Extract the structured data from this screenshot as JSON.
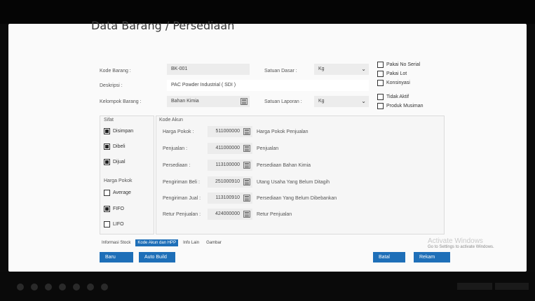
{
  "title": "Data Barang / Persediaan",
  "form": {
    "kode_barang_label": "Kode Barang :",
    "kode_barang_value": "BK-001",
    "deskripsi_label": "Deskripsi :",
    "deskripsi_value": "PAC Powder Industrial ( SDI )",
    "kelompok_label": "Kelompok Barang :",
    "kelompok_value": "Bahan Kimia",
    "satuan_dasar_label": "Satuan Dasar :",
    "satuan_dasar_value": "Kg",
    "satuan_laporan_label": "Satuan Laporan :",
    "satuan_laporan_value": "Kg"
  },
  "options": [
    {
      "label": "Pakai No Serial",
      "checked": false
    },
    {
      "label": "Pakai Lot",
      "checked": false
    },
    {
      "label": "Konsinyasi",
      "checked": false
    },
    {
      "label": "Tidak Aktif",
      "checked": false
    },
    {
      "label": "Produk Musiman",
      "checked": false
    }
  ],
  "sifat": {
    "header": "Sifat",
    "items": [
      {
        "label": "Disimpan",
        "checked": true
      },
      {
        "label": "Dibeli",
        "checked": true
      },
      {
        "label": "Dijual",
        "checked": true
      }
    ]
  },
  "harga_pokok": {
    "header": "Harga Pokok",
    "items": [
      {
        "label": "Average",
        "checked": false
      },
      {
        "label": "FIFO",
        "checked": true
      },
      {
        "label": "LIFO",
        "checked": false
      }
    ]
  },
  "kode_akun": {
    "header": "Kode Akun",
    "rows": [
      {
        "label": "Harga Pokok :",
        "code": "511000000",
        "desc": "Harga Pokok Penjualan"
      },
      {
        "label": "Penjualan :",
        "code": "411000000",
        "desc": "Penjualan"
      },
      {
        "label": "Persediaan :",
        "code": "113100000",
        "desc": "Persediaan Bahan Kimia"
      },
      {
        "label": "Pengiriman Beli :",
        "code": "251000910",
        "desc": "Utang Usaha Yang Belum Ditagih"
      },
      {
        "label": "Pengiriman Jual :",
        "code": "113100910",
        "desc": "Persediaan Yang Belum Dibebankan"
      },
      {
        "label": "Retur Penjualan :",
        "code": "424000000",
        "desc": "Retur Penjualan"
      }
    ]
  },
  "tabs": [
    "Informasi Stock",
    "Kode Akun dan HPP",
    "Info Lain",
    "Gambar"
  ],
  "buttons": {
    "baru": "Baru",
    "auto_build": "Auto Build",
    "batal": "Batal",
    "rekam": "Rekam"
  },
  "watermark": {
    "line1": "Activate Windows",
    "line2": "Go to Settings to activate Windows."
  },
  "colors": {
    "accent": "#1e6fb8",
    "background": "#fafafa"
  }
}
